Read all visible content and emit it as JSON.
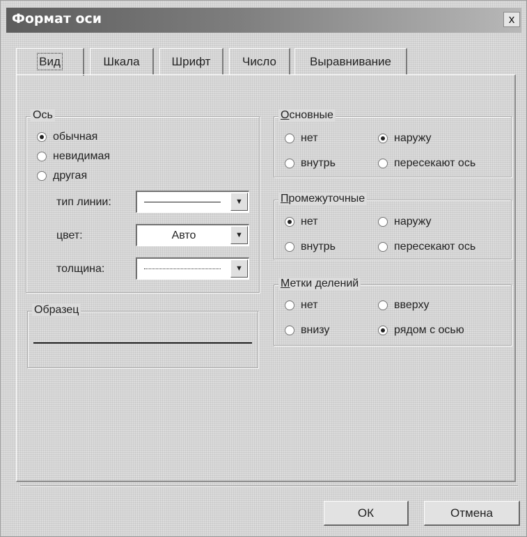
{
  "window": {
    "title": "Формат оси",
    "close_label": "x"
  },
  "tabs": [
    {
      "label": "Вид",
      "active": true
    },
    {
      "label": "Шкала",
      "active": false
    },
    {
      "label": "Шрифт",
      "active": false
    },
    {
      "label": "Число",
      "active": false
    },
    {
      "label": "Выравнивание",
      "active": false
    }
  ],
  "axis": {
    "legend": "Ось",
    "options": [
      {
        "label": "обычная",
        "checked": true
      },
      {
        "label": "невидимая",
        "checked": false
      },
      {
        "label": "другая",
        "checked": false
      }
    ],
    "line_type_label": "тип линии:",
    "color_label": "цвет:",
    "color_value": "Авто",
    "weight_label": "толщина:"
  },
  "sample": {
    "legend": "Образец"
  },
  "major": {
    "legend": "Основные",
    "options": [
      {
        "label": "нет",
        "checked": false
      },
      {
        "label": "наружу",
        "checked": true
      },
      {
        "label": "внутрь",
        "checked": false
      },
      {
        "label": "пересекают ось",
        "checked": false
      }
    ]
  },
  "minor": {
    "legend": "Промежуточные",
    "options": [
      {
        "label": "нет",
        "checked": true
      },
      {
        "label": "наружу",
        "checked": false
      },
      {
        "label": "внутрь",
        "checked": false
      },
      {
        "label": "пересекают ось",
        "checked": false
      }
    ]
  },
  "tick_labels": {
    "legend": "Метки делений",
    "options": [
      {
        "label": "нет",
        "checked": false
      },
      {
        "label": "вверху",
        "checked": false
      },
      {
        "label": "внизу",
        "checked": false
      },
      {
        "label": "рядом с осью",
        "checked": true
      }
    ]
  },
  "buttons": {
    "ok": "ОК",
    "cancel": "Отмена"
  }
}
